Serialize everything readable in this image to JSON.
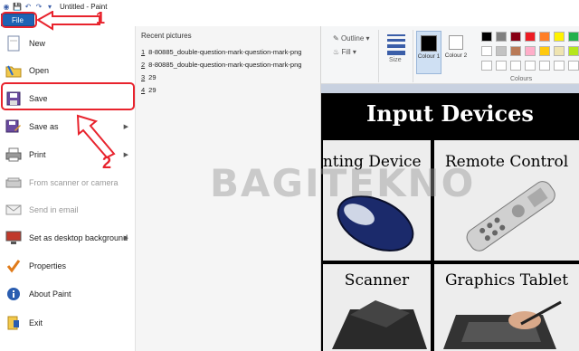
{
  "titlebar": {
    "app_title": "Untitled - Paint",
    "qa_icons": [
      "save-icon",
      "undo-icon",
      "redo-icon",
      "customize-icon"
    ]
  },
  "file_tab": {
    "label": "File"
  },
  "menu": {
    "items": [
      {
        "label": "New",
        "icon": "new-file-icon"
      },
      {
        "label": "Open",
        "icon": "open-folder-icon"
      },
      {
        "label": "Save",
        "icon": "save-disk-icon"
      },
      {
        "label": "Save as",
        "icon": "save-as-icon",
        "submenu": true
      },
      {
        "label": "Print",
        "icon": "printer-icon",
        "submenu": true
      },
      {
        "label": "From scanner or camera",
        "icon": "scanner-icon",
        "disabled": true
      },
      {
        "label": "Send in email",
        "icon": "email-icon",
        "disabled": true
      },
      {
        "label": "Set as desktop background",
        "icon": "desktop-icon",
        "submenu": true
      },
      {
        "label": "Properties",
        "icon": "checkmark-icon"
      },
      {
        "label": "About Paint",
        "icon": "info-icon"
      },
      {
        "label": "Exit",
        "icon": "exit-icon"
      }
    ]
  },
  "recent": {
    "header": "Recent pictures",
    "items": [
      {
        "num": "1",
        "name": "8-80885_double-question-mark-question-mark-png"
      },
      {
        "num": "2",
        "name": "8-80885_double-question-mark-question-mark-png"
      },
      {
        "num": "3",
        "name": "29"
      },
      {
        "num": "4",
        "name": "29"
      }
    ]
  },
  "ribbon": {
    "outline_label": "Outline",
    "fill_label": "Fill",
    "size_label": "Size",
    "colour1_label": "Colour 1",
    "colour2_label": "Colour 2",
    "colours_group_label": "Colours",
    "palette_row1": [
      "#000000",
      "#7f7f7f",
      "#880015",
      "#ed1c24",
      "#ff7f27",
      "#fff200",
      "#22b14c",
      "#00a2e8",
      "#3f48cc",
      "#a349a4"
    ],
    "palette_row2": [
      "#ffffff",
      "#c3c3c3",
      "#b97a57",
      "#ffaec9",
      "#ffc90e",
      "#efe4b0",
      "#b5e61d",
      "#99d9ea",
      "#7092be",
      "#c8bfe7"
    ]
  },
  "canvas": {
    "poster_title": "Input Devices",
    "cells": [
      "inting Device",
      "Remote Control",
      "Scanner",
      "Graphics Tablet"
    ]
  },
  "annotations": {
    "step1": "1",
    "step2": "2",
    "watermark": "BAGITEKNO",
    "accent": "#e8232d"
  }
}
